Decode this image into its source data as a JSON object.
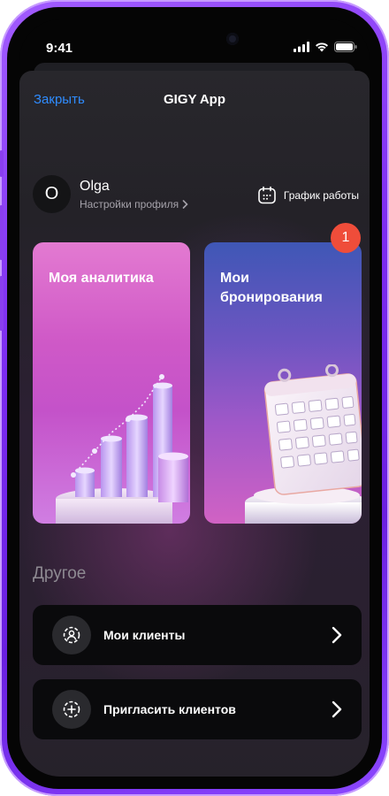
{
  "status_bar": {
    "time": "9:41",
    "icons": [
      "cellular-signal-icon",
      "wifi-icon",
      "battery-icon"
    ]
  },
  "nav": {
    "close_label": "Закрыть",
    "title": "GIGY App"
  },
  "profile": {
    "avatar_initial": "O",
    "name": "Olga",
    "settings_link": "Настройки профиля"
  },
  "schedule": {
    "label": "График работы",
    "icon": "calendar-icon"
  },
  "cards": [
    {
      "title": "Моя аналитика",
      "illustration": "bar-chart-illustration"
    },
    {
      "title": "Мои бронирования",
      "illustration": "calendar-illustration",
      "badge_count": "1"
    }
  ],
  "other": {
    "section_title": "Другое",
    "items": [
      {
        "label": "Мои клиенты",
        "icon": "clients-icon"
      },
      {
        "label": "Пригласить клиентов",
        "icon": "add-circle-icon"
      }
    ]
  },
  "colors": {
    "accent": "#2f8cff",
    "badge": "#ef4d3a",
    "frame": "#7c2cf0"
  }
}
